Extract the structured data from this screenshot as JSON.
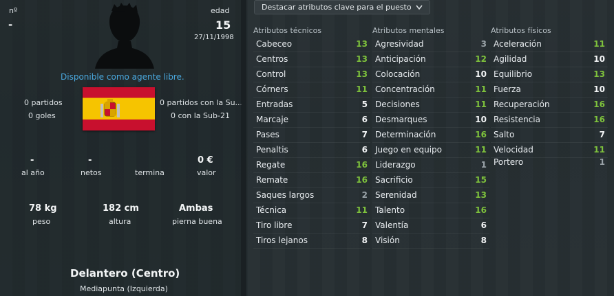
{
  "header": {
    "number_label": "nº",
    "number_value": "-",
    "age_label": "edad",
    "age_value": "15",
    "birthdate": "27/11/1998"
  },
  "status_text": "Disponible como agente libre.",
  "career": {
    "partidos": "0 partidos",
    "goles": "0 goles",
    "sub_partidos": "0 partidos con la Su...",
    "sub_goles": "0 con la Sub-21"
  },
  "contract": {
    "salary_value": "-",
    "salary_label": "al año",
    "net_value": "-",
    "net_label": "netos",
    "ends_label": "termina",
    "value_value": "0 €",
    "value_label": "valor"
  },
  "physical": {
    "weight_value": "78 kg",
    "weight_label": "peso",
    "height_value": "182 cm",
    "height_label": "altura",
    "foot_value": "Ambas",
    "foot_label": "pierna buena"
  },
  "position": {
    "main": "Delantero (Centro)",
    "secondary": "Mediapunta (Izquierda)"
  },
  "dropdown_label": "Destacar atributos clave para el puesto",
  "headers": {
    "technical": "Atributos técnicos",
    "mental": "Atributos mentales",
    "physical": "Atributos físicos"
  },
  "technical": [
    {
      "name": "Cabeceo",
      "value": "13"
    },
    {
      "name": "Centros",
      "value": "13"
    },
    {
      "name": "Control",
      "value": "13"
    },
    {
      "name": "Córners",
      "value": "11"
    },
    {
      "name": "Entradas",
      "value": "5"
    },
    {
      "name": "Marcaje",
      "value": "6"
    },
    {
      "name": "Pases",
      "value": "7"
    },
    {
      "name": "Penaltis",
      "value": "6"
    },
    {
      "name": "Regate",
      "value": "16"
    },
    {
      "name": "Remate",
      "value": "16"
    },
    {
      "name": "Saques largos",
      "value": "2"
    },
    {
      "name": "Técnica",
      "value": "11"
    },
    {
      "name": "Tiro libre",
      "value": "7"
    },
    {
      "name": "Tiros lejanos",
      "value": "8"
    }
  ],
  "mental": [
    {
      "name": "Agresividad",
      "value": "3"
    },
    {
      "name": "Anticipación",
      "value": "12"
    },
    {
      "name": "Colocación",
      "value": "10"
    },
    {
      "name": "Concentración",
      "value": "11"
    },
    {
      "name": "Decisiones",
      "value": "11"
    },
    {
      "name": "Desmarques",
      "value": "10"
    },
    {
      "name": "Determinación",
      "value": "16"
    },
    {
      "name": "Juego en equipo",
      "value": "11"
    },
    {
      "name": "Liderazgo",
      "value": "1"
    },
    {
      "name": "Sacrificio",
      "value": "15"
    },
    {
      "name": "Serenidad",
      "value": "13"
    },
    {
      "name": "Talento",
      "value": "16"
    },
    {
      "name": "Valentía",
      "value": "6"
    },
    {
      "name": "Visión",
      "value": "8"
    }
  ],
  "physical_attrs": [
    {
      "name": "Aceleración",
      "value": "11"
    },
    {
      "name": "Agilidad",
      "value": "10"
    },
    {
      "name": "Equilibrio",
      "value": "13"
    },
    {
      "name": "Fuerza",
      "value": "10"
    },
    {
      "name": "Recuperación",
      "value": "16"
    },
    {
      "name": "Resistencia",
      "value": "16"
    },
    {
      "name": "Salto",
      "value": "7"
    },
    {
      "name": "Velocidad",
      "value": "11"
    }
  ],
  "goalkeeper": {
    "name": "Portero",
    "value": "1"
  },
  "colors": {
    "high": "#7ec23c",
    "normal": "#f2f4f5",
    "low": "#9aa3a8",
    "link": "#4aa9df"
  }
}
